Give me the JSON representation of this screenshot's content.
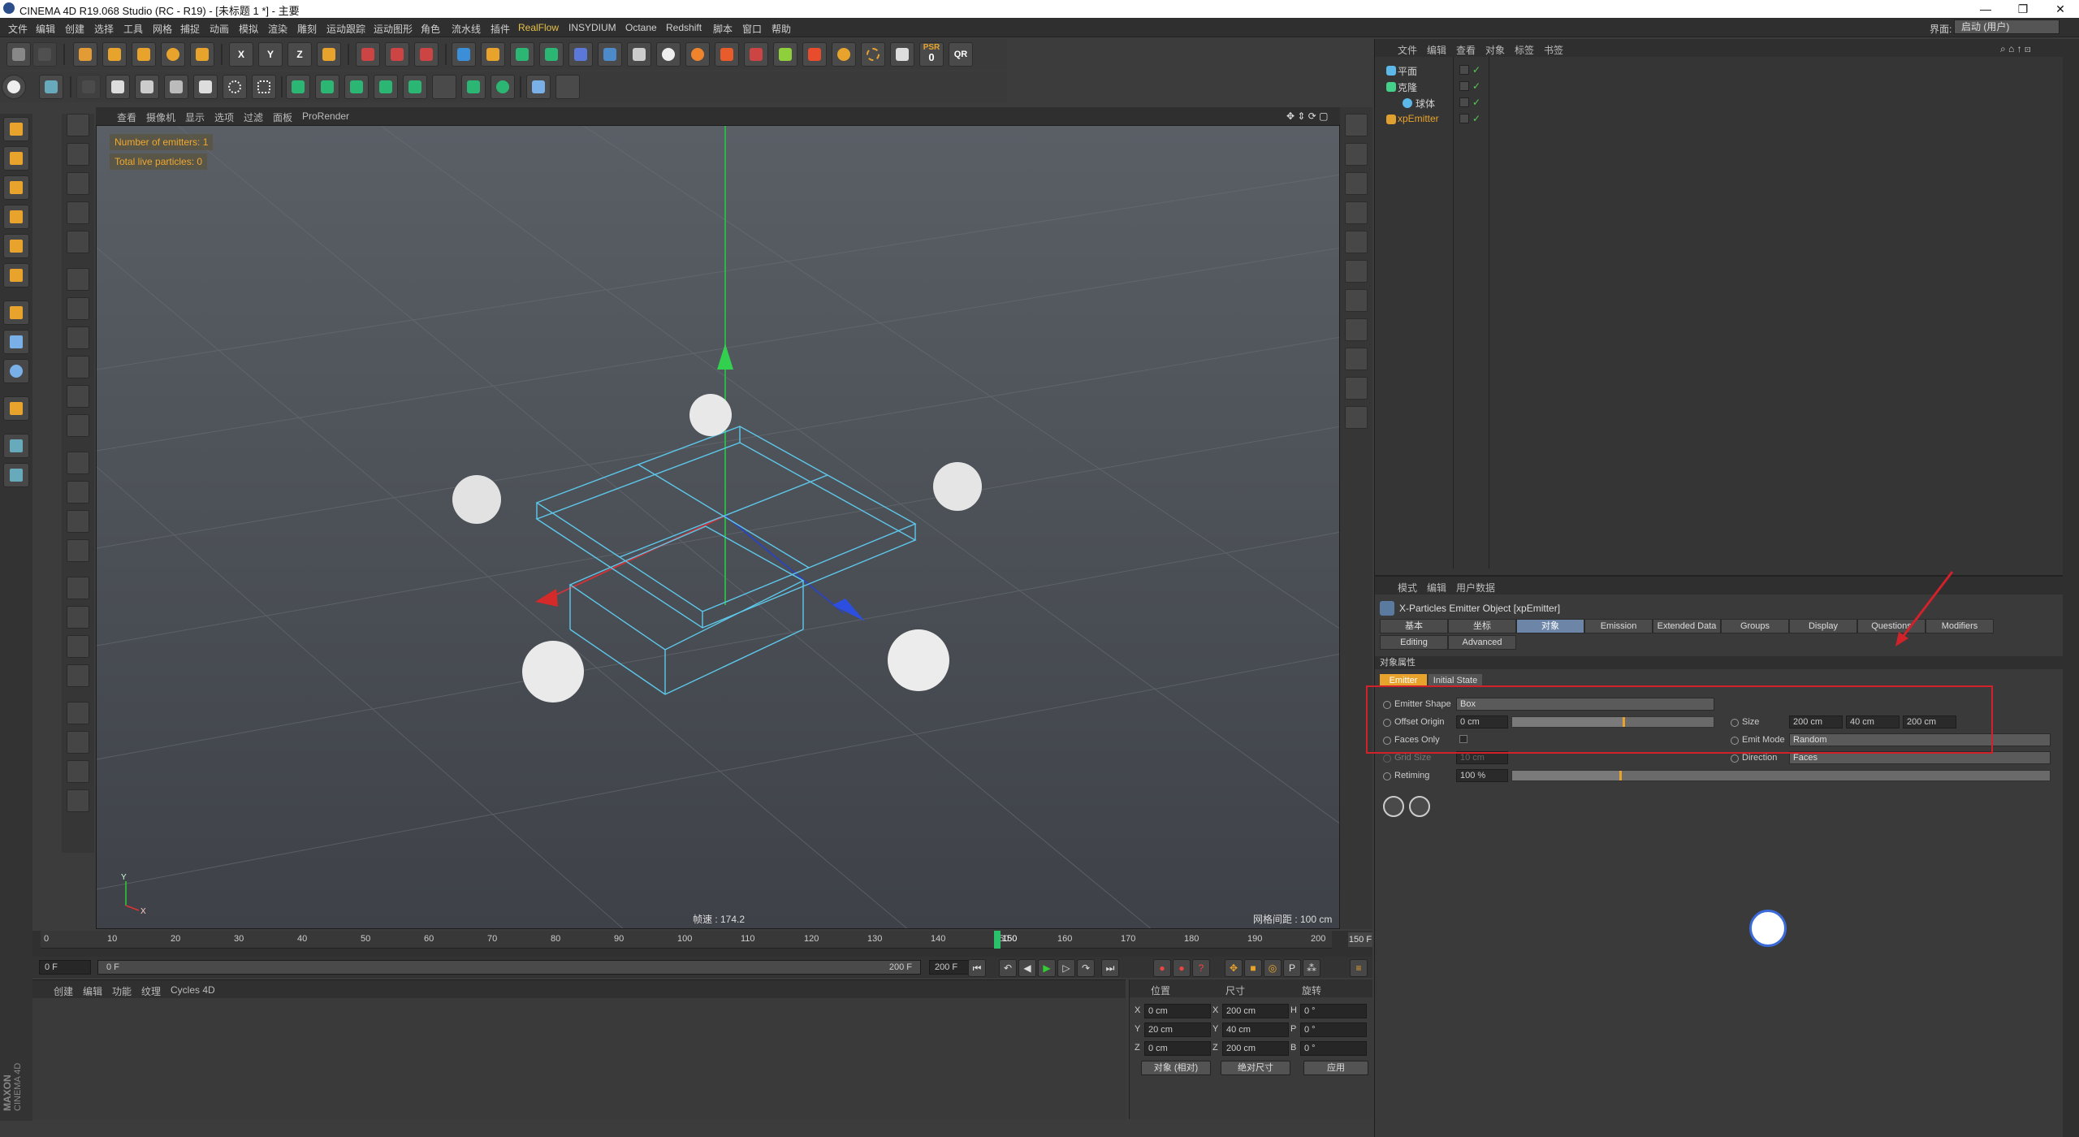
{
  "app": {
    "title": "CINEMA 4D R19.068 Studio (RC - R19) - [未标题 1 *] - 主要"
  },
  "window_controls": {
    "min": "—",
    "max": "❐",
    "close": "✕"
  },
  "menubar": {
    "items": [
      "文件",
      "编辑",
      "创建",
      "选择",
      "工具",
      "网格",
      "捕捉",
      "动画",
      "模拟",
      "渲染",
      "雕刻",
      "运动跟踪",
      "运动图形",
      "角色",
      "流水线",
      "插件",
      "RealFlow",
      "INSYDIUM",
      "Octane",
      "Redshift",
      "脚本",
      "窗口",
      "帮助"
    ],
    "layout_label": "界面:",
    "layout_value": "启动 (用户)"
  },
  "toolbar": {
    "x_label": "X",
    "y_label": "Y",
    "z_label": "Z",
    "psr_label": "PSR",
    "psr_value": "0",
    "qr_label": "QR"
  },
  "viewport": {
    "menu": [
      "查看",
      "摄像机",
      "显示",
      "选项",
      "过滤",
      "面板",
      "ProRender"
    ],
    "hud_emitters": "Number of emitters: 1",
    "hud_particles": "Total live particles: 0",
    "fps": "帧速 : 174.2",
    "grid": "网格间距 : 100 cm",
    "axis_y": "Y",
    "axis_x": "X"
  },
  "timeline": {
    "ticks": [
      "0",
      "10",
      "20",
      "30",
      "40",
      "50",
      "60",
      "70",
      "80",
      "90",
      "100",
      "110",
      "120",
      "130",
      "140",
      "150",
      "160",
      "170",
      "180",
      "190",
      "200"
    ],
    "current": "150",
    "end_frame": "150 F",
    "start_field": "0 F",
    "range_start": "0 F",
    "range_end": "200 F",
    "max_field": "200 F"
  },
  "materials": {
    "menu": [
      "创建",
      "编辑",
      "功能",
      "纹理",
      "Cycles 4D"
    ],
    "maxon": "MAXON",
    "c4d": "CINEMA 4D"
  },
  "coords": {
    "headers": [
      "位置",
      "尺寸",
      "旋转"
    ],
    "rows": [
      {
        "a": "X",
        "p": "0 cm",
        "b": "X",
        "s": "200 cm",
        "c": "H",
        "r": "0 °"
      },
      {
        "a": "Y",
        "p": "20 cm",
        "b": "Y",
        "s": "40 cm",
        "c": "P",
        "r": "0 °"
      },
      {
        "a": "Z",
        "p": "0 cm",
        "b": "Z",
        "s": "200 cm",
        "c": "B",
        "r": "0 °"
      }
    ],
    "mode1": "对象 (相对)",
    "mode2": "绝对尺寸",
    "apply": "应用"
  },
  "objects": {
    "menu": [
      "文件",
      "编辑",
      "查看",
      "对象",
      "标签",
      "书签"
    ],
    "items": [
      {
        "name": "平面",
        "color": "#5bb8e8"
      },
      {
        "name": "克隆",
        "color": "#45d08a"
      },
      {
        "name": "球体",
        "color": "#5bb8e8"
      },
      {
        "name": "xpEmitter",
        "color": "#e0a030"
      }
    ]
  },
  "attributes": {
    "menu": [
      "模式",
      "编辑",
      "用户数据"
    ],
    "title": "X-Particles Emitter Object [xpEmitter]",
    "tabs_row1": [
      "基本",
      "坐标",
      "对象",
      "Emission",
      "Extended Data",
      "Groups",
      "Display",
      "Questions",
      "Modifiers"
    ],
    "tabs_row2": [
      "Editing",
      "Advanced"
    ],
    "section": "对象属性",
    "subtabs": [
      "Emitter",
      "Initial State"
    ],
    "emitter_shape_label": "Emitter Shape",
    "emitter_shape": "Box",
    "offset_origin_label": "Offset Origin",
    "offset_origin": "0 cm",
    "offset_slider": 0.55,
    "size_label": "Size",
    "size_x": "200 cm",
    "size_y": "40 cm",
    "size_z": "200 cm",
    "faces_only_label": "Faces Only",
    "emit_mode_label": "Emit Mode",
    "emit_mode": "Random",
    "grid_size_label": "Grid Size",
    "grid_size": "10 cm",
    "direction_label": "Direction",
    "direction": "Faces",
    "retiming_label": "Retiming",
    "retiming": "100 %",
    "retiming_slider": 0.2
  },
  "colors": {
    "accent": "#e8a32c",
    "highlight": "#d1212b",
    "active_tab": "#6d86a8"
  }
}
